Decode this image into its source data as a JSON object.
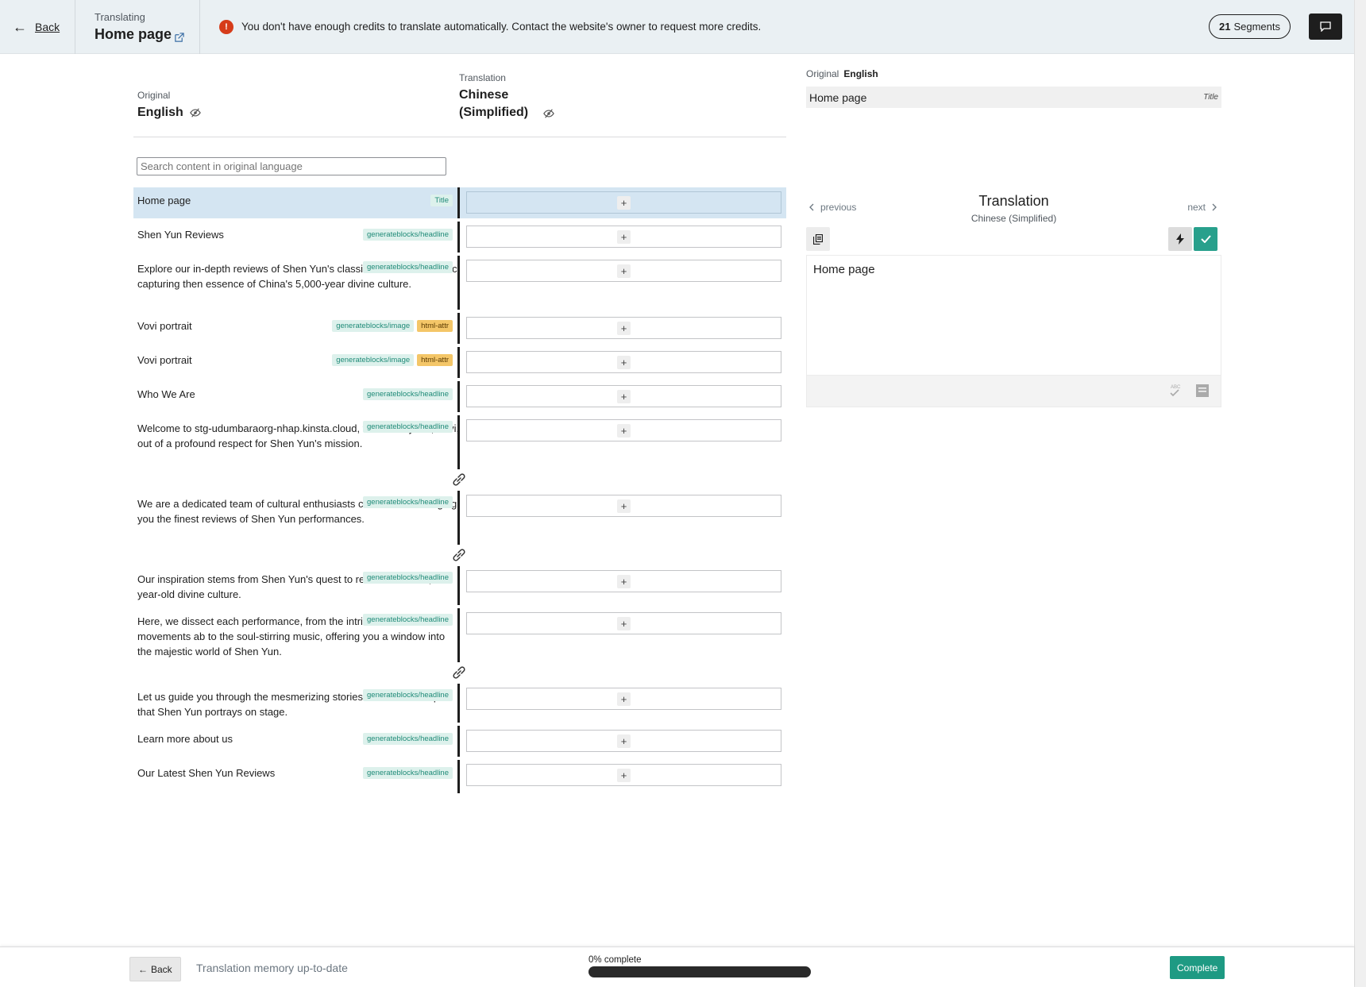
{
  "header": {
    "back_label": "Back",
    "translating_label": "Translating",
    "page_title": "Home page",
    "notice": "You don't have enough credits to translate automatically. Contact the website's owner to request more credits.",
    "segments_count": "21",
    "segments_label": "Segments"
  },
  "columns": {
    "original_label": "Original",
    "original_lang": "English",
    "translation_label": "Translation",
    "translation_lang": "Chinese (Simplified)"
  },
  "search": {
    "placeholder": "Search content in original language"
  },
  "segments": [
    {
      "text": "Home page",
      "tags": [
        "Title"
      ]
    },
    {
      "text": "Shen Yun Reviews",
      "tags": [
        "generateblocks/headline"
      ]
    },
    {
      "text": "Explore our in-depth reviews of Shen Yun's classical dance and music, capturing then essence of China's 5,000-year divine culture.",
      "tags": [
        "generateblocks/headline"
      ]
    },
    {
      "text": "Vovi portrait",
      "tags": [
        "generateblocks/image",
        "html-attr"
      ]
    },
    {
      "text": "Vovi portrait",
      "tags": [
        "generateblocks/image",
        "html-attr"
      ]
    },
    {
      "text": "Who We Are",
      "tags": [
        "generateblocks/headline"
      ]
    },
    {
      "text": "Welcome to stg-udumbaraorg-nhap.kinsta.cloud, founded by me, Vovi, out of a profound respect for Shen Yun's mission.",
      "tags": [
        "generateblocks/headline"
      ]
    },
    {
      "text": "We are a dedicated team of cultural enthusiasts committed to bringing you the finest reviews of Shen Yun performances.",
      "tags": [
        "generateblocks/headline"
      ]
    },
    {
      "text": "Our inspiration stems from Shen Yun's quest to revive China's 5,000-year-old divine culture.",
      "tags": [
        "generateblocks/headline"
      ]
    },
    {
      "text": "Here, we dissect each performance, from the intricate dance movements ab to the soul-stirring music, offering you a window into the majestic world of Shen Yun.",
      "tags": [
        "generateblocks/headline"
      ]
    },
    {
      "text": "Let us guide you through the mesmerizing stories and cultural depths that Shen Yun portrays on stage.",
      "tags": [
        "generateblocks/headline"
      ]
    },
    {
      "text": "Learn more about us",
      "tags": [
        "generateblocks/headline"
      ]
    },
    {
      "text": "Our Latest Shen Yun Reviews",
      "tags": [
        "generateblocks/headline"
      ]
    }
  ],
  "right_panel": {
    "original_label": "Original",
    "original_lang": "English",
    "original_text": "Home page",
    "original_type": "Title",
    "prev_label": "previous",
    "next_label": "next",
    "translation_title": "Translation",
    "translation_lang": "Chinese (Simplified)",
    "editor_text": "Home page"
  },
  "footer": {
    "back_label": "Back",
    "memory_status": "Translation memory up-to-date",
    "progress_label": "0% complete",
    "progress_fraction": 0,
    "complete_label": "Complete"
  },
  "colors": {
    "accent": "#28a08c",
    "active_row": "#d4e5f2",
    "notice_icon": "#d63c1a",
    "tag_green_bg": "#ddf1ec",
    "tag_orange_bg": "#f4c668"
  },
  "icons": {
    "back": "arrow-left-icon",
    "external": "external-link-icon",
    "notice": "error-icon",
    "comment": "comment-icon",
    "eye": "eye-off-icon",
    "plus": "plus-icon",
    "link": "link-icon",
    "copy": "copy-icon",
    "flash": "lightning-icon",
    "check": "check-icon"
  }
}
